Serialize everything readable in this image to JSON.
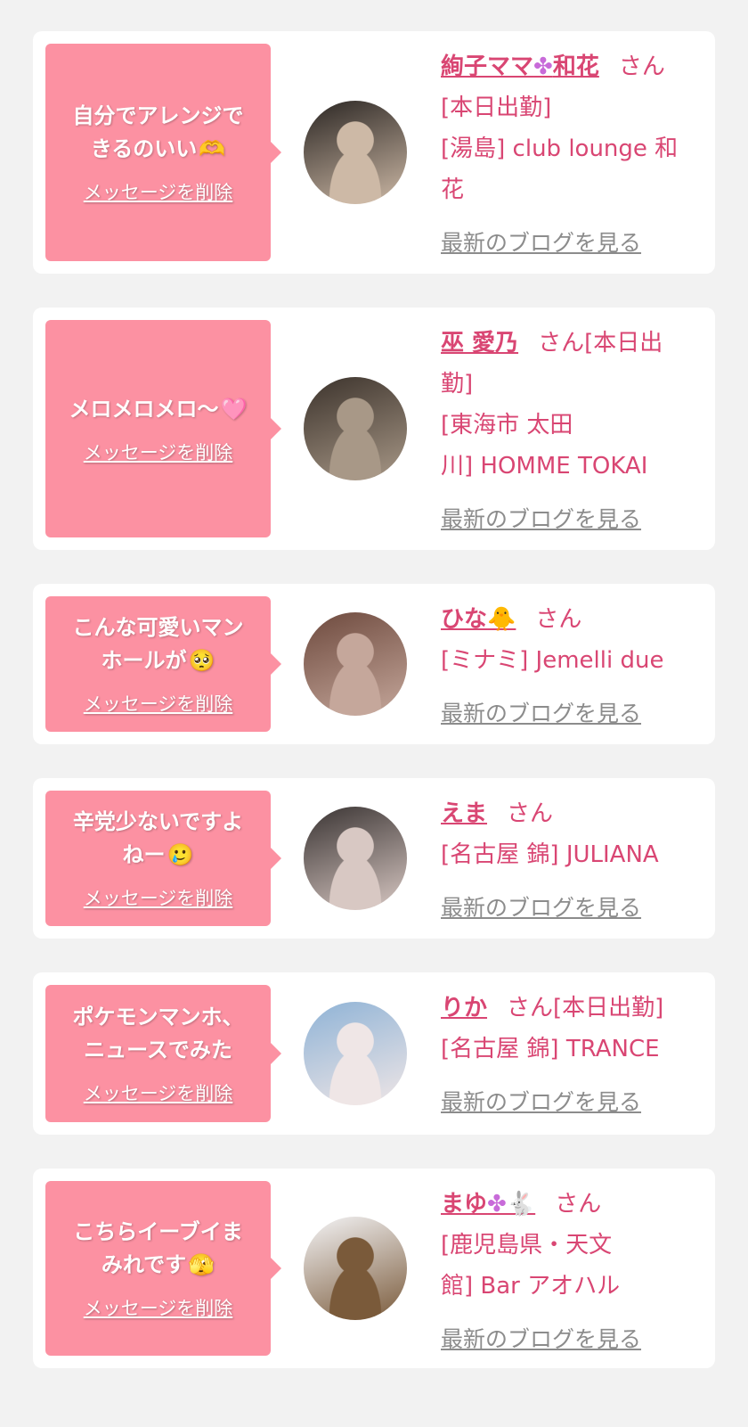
{
  "delete_label": "メッセージを削除",
  "blog_label": "最新のブログを見る",
  "cards": [
    {
      "message_lines": [
        "自分でアレンジで",
        "きるのいい"
      ],
      "message_emoji": "🫶",
      "name": "絢子ママ",
      "name_deco": "✤",
      "name_tail": "和花",
      "suffix": "さん",
      "info_lines": [
        "[本日出勤]",
        "[湯島] club lounge 和",
        "花"
      ],
      "avatar_colors": [
        "#2b2623",
        "#cdb9a6"
      ]
    },
    {
      "message_lines": [
        "メロメロメロ〜"
      ],
      "message_emoji": "🩷",
      "name": "巫 愛乃",
      "name_deco": "",
      "name_tail": "",
      "suffix": "さん[本日出",
      "info_lines": [
        "勤]",
        "[東海市 太田",
        "川] HOMME TOKAI"
      ],
      "avatar_colors": [
        "#3c332c",
        "#a89887"
      ]
    },
    {
      "message_lines": [
        "こんな可愛いマン",
        "ホールが"
      ],
      "message_emoji": "🥺",
      "name": "ひな",
      "name_deco": "🐥",
      "name_tail": "",
      "suffix": "さん",
      "info_lines": [
        "[ミナミ] Jemelli due"
      ],
      "avatar_colors": [
        "#6e4a3e",
        "#c5a79b"
      ]
    },
    {
      "message_lines": [
        "辛党少ないですよ",
        "ねー"
      ],
      "message_emoji": "🥲",
      "name": "えま",
      "name_deco": "",
      "name_tail": "",
      "suffix": "さん",
      "info_lines": [
        "[名古屋 錦] JULIANA"
      ],
      "avatar_colors": [
        "#3a3433",
        "#d8c8c3"
      ]
    },
    {
      "message_lines": [
        "ポケモンマンホ、",
        "ニュースでみた"
      ],
      "message_emoji": "",
      "name": "りか",
      "name_deco": "",
      "name_tail": "",
      "suffix": "さん[本日出勤]",
      "info_lines": [
        "[名古屋 錦] TRANCE"
      ],
      "avatar_colors": [
        "#8fb3d6",
        "#efe6e6"
      ]
    },
    {
      "message_lines": [
        "こちらイーブイま",
        "みれです"
      ],
      "message_emoji": "🫣",
      "name": "まゆ",
      "name_deco": "✤🐇",
      "name_tail": "",
      "suffix": "さん",
      "info_lines": [
        "[鹿児島県・天文",
        "館] Bar アオハル"
      ],
      "avatar_colors": [
        "#f4f4f6",
        "#7a5a3a"
      ]
    }
  ]
}
